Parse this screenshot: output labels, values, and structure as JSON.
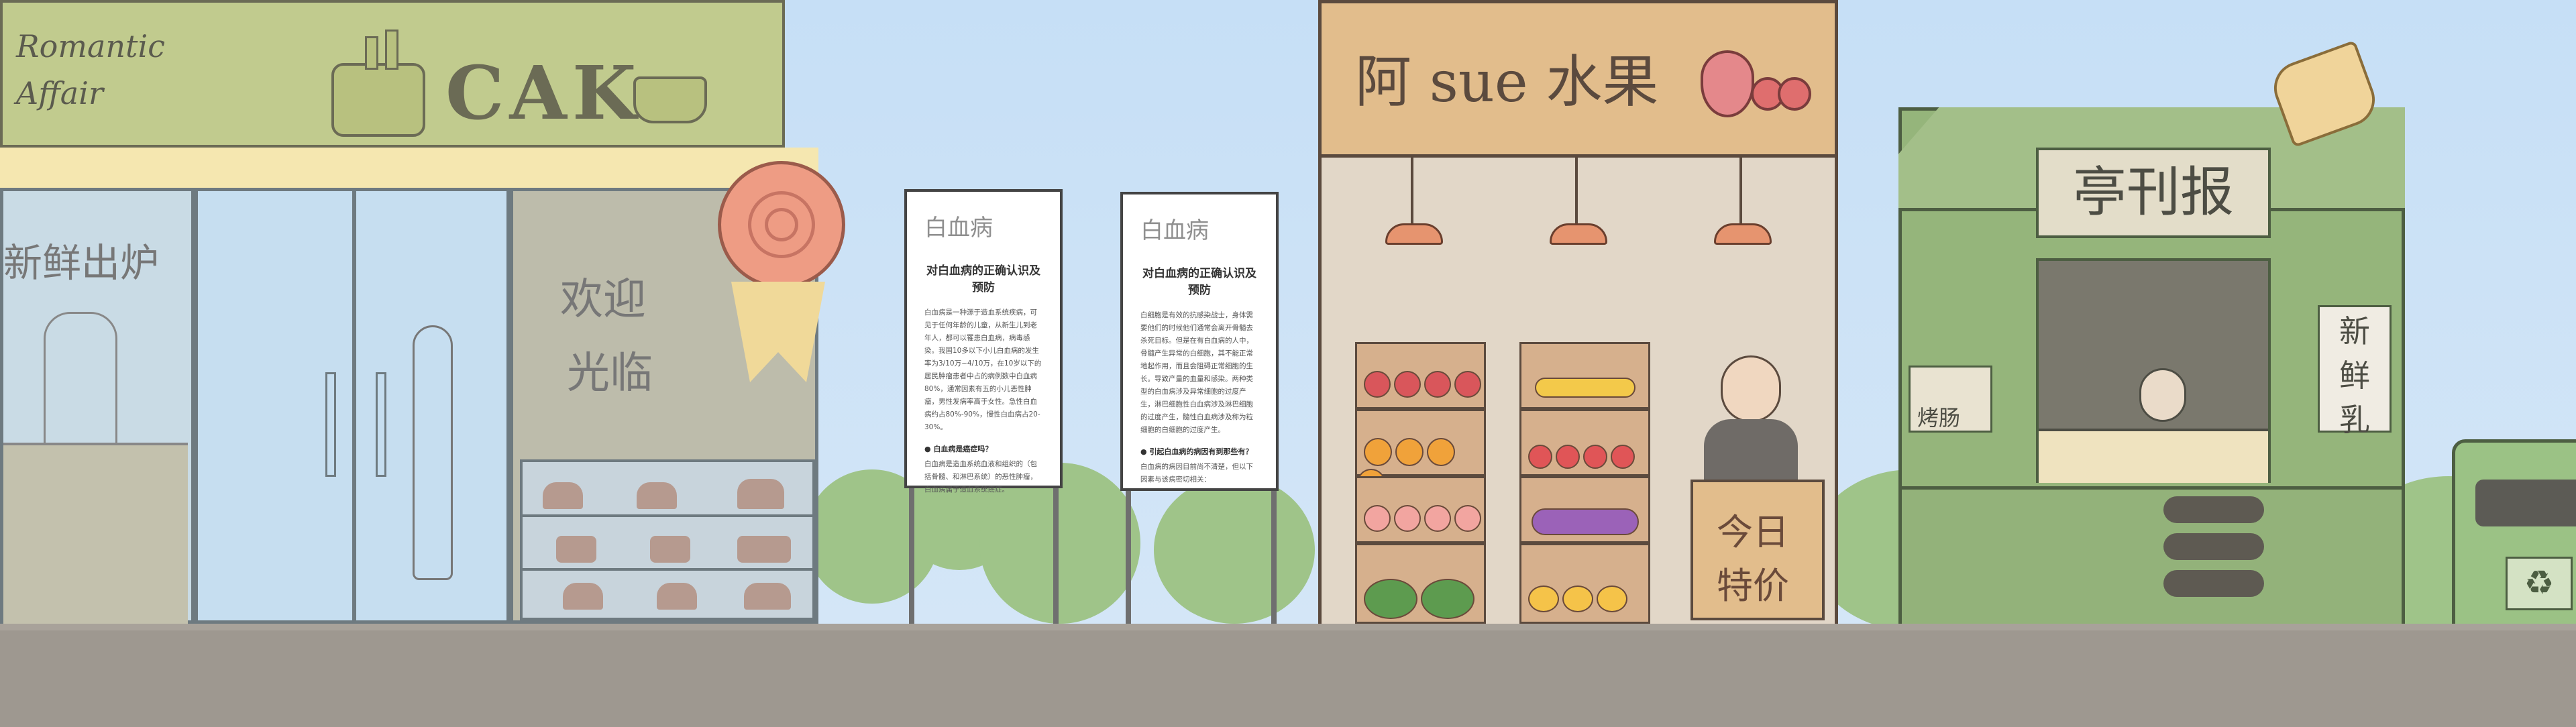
{
  "bakery": {
    "sign_script": "Romantic Affair",
    "sign_word": "CAK",
    "window_left_text": "新鲜出炉",
    "window_welcome_line1": "欢迎",
    "window_welcome_line2": "光临"
  },
  "notice_boards": [
    {
      "title": "白血病",
      "heading": "对白血病的正确认识及预防",
      "body": "白血病是一种源于造血系统疾病，可见于任何年龄的儿童，从新生儿到老年人，都可以罹患白血病，病毒感染。我国10多以下小儿白血病的发生率为3/10万~4/10万，在10岁以下的居民肿瘤患者中占的病例数中白血病80%，通常因素有五的小儿恶性肿瘤，男性发病率高于女性。急性白血病约占80%-90%，慢性白血病占20-30%。",
      "question": "白血病是癌症吗？",
      "answer": "白血病是造血系统血液和组织的（包括骨髓、和淋巴系统）的恶性肿瘤，白血病属于造血系统癌症。"
    },
    {
      "title": "白血病",
      "heading": "对白血病的正确认识及预防",
      "body": "白细胞是有效的抗感染战士，身体需要他们的时候他们通常会离开骨髓去杀死目标。但是在有白血病的人中，骨髓产生异常的白细胞，其不能正常地起作用，而且会阻碍正常细胞的生长。导致产量的血量和感染。两种类型的白血病涉及异常细胞的过度产生，淋巴细胞性白血病涉及淋巴细胞的过度产生，髓性白血病涉及称为粒细胞的白细胞的过度产生。",
      "question": "引起白血病的病因有到那些有？",
      "answer": "白血病的病因目前尚不清楚，但以下因素与该病密切相关："
    }
  ],
  "fruit_stand": {
    "sign_text": "阿 sue 水果",
    "special_line1": "今日",
    "special_line2": "特价"
  },
  "kiosk": {
    "sign_text": "亭刊报",
    "side_sign_line1": "新",
    "side_sign_line2": "鲜",
    "side_sign_line3": "乳",
    "snack_label": "烤肠"
  },
  "recycle_bin": {
    "icon": "recycle-icon"
  },
  "colors": {
    "sky": "#c9e0f6",
    "bakery_sign": "#c1cb8e",
    "bakery_awning": "#f5e7b0",
    "fruit_stand": "#e2bd8c",
    "kiosk_green": "#95b57b",
    "ground": "#9e9890"
  }
}
